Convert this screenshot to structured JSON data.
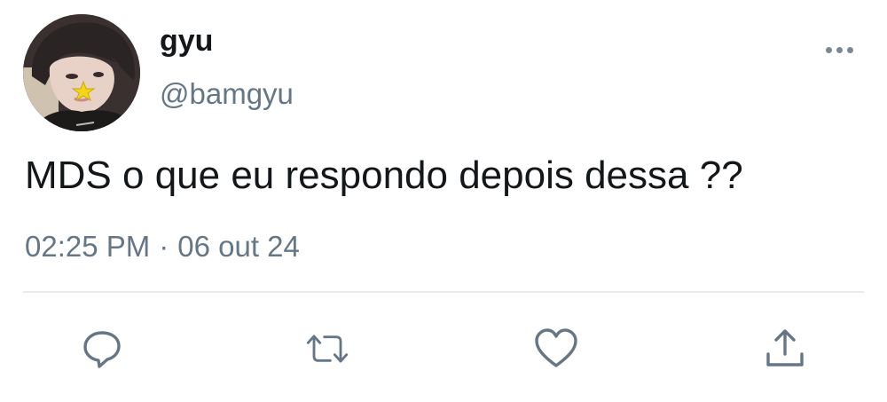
{
  "author": {
    "display_name": "gyu",
    "handle": "@bamgyu",
    "avatar_icon": "profile-photo"
  },
  "tweet": {
    "text": "MDS o que eu respondo depois dessa ??",
    "time": "02:25 PM",
    "separator": "·",
    "date": "06 out 24"
  },
  "actions": {
    "reply_icon": "comment-icon",
    "retweet_icon": "retweet-icon",
    "like_icon": "heart-icon",
    "share_icon": "share-icon",
    "icon_color": "#657786"
  },
  "colors": {
    "text_primary": "#14171a",
    "text_secondary": "#657786",
    "divider": "#e6ecf0"
  }
}
